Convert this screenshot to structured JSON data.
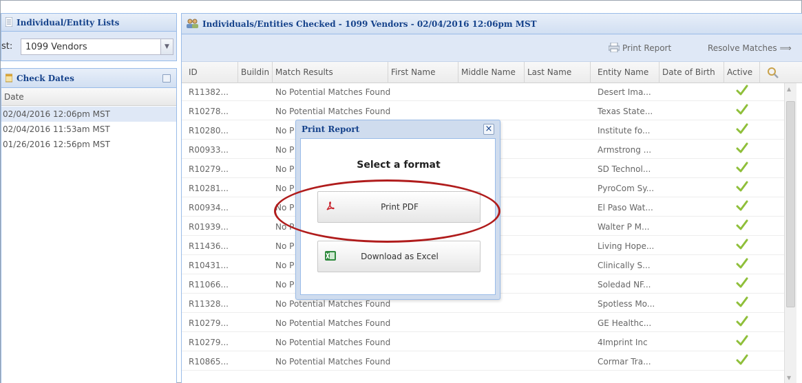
{
  "left_panel": {
    "lists_header": "Individual/Entity Lists",
    "list_label": "st:",
    "list_value": "1099 Vendors",
    "dates_header": "Check Dates",
    "dates_column": "Date",
    "dates": [
      "02/04/2016 12:06pm MST",
      "02/04/2016 11:53am MST",
      "01/26/2016 12:56pm MST"
    ]
  },
  "main_panel": {
    "title": "Individuals/Entities Checked - 1099 Vendors - 02/04/2016 12:06pm MST",
    "toolbar": {
      "print_report": "Print Report",
      "resolve_matches": "Resolve Matches ⟹"
    },
    "columns": [
      "ID",
      "Buildin",
      "Match Results",
      "First Name",
      "Middle Name",
      "Last Name",
      "Entity Name",
      "Date of Birth",
      "Active"
    ],
    "rows": [
      {
        "id": "R11382...",
        "match": "No Potential Matches Found",
        "entity": "Desert Ima..."
      },
      {
        "id": "R10278...",
        "match": "No Potential Matches Found",
        "entity": "Texas State..."
      },
      {
        "id": "R10280...",
        "match": "No P",
        "entity": "Institute fo..."
      },
      {
        "id": "R00933...",
        "match": "No P",
        "entity": "Armstrong ..."
      },
      {
        "id": "R10279...",
        "match": "No P",
        "entity": "SD Technol..."
      },
      {
        "id": "R10281...",
        "match": "No P",
        "entity": "PyroCom Sy..."
      },
      {
        "id": "R00934...",
        "match": "No P",
        "entity": "El Paso Wat..."
      },
      {
        "id": "R01939...",
        "match": "No P",
        "entity": "Walter P M..."
      },
      {
        "id": "R11436...",
        "match": "No P",
        "entity": "Living Hope..."
      },
      {
        "id": "R10431...",
        "match": "No P",
        "entity": "Clinically S..."
      },
      {
        "id": "R11066...",
        "match": "No P",
        "entity": "Soledad NF..."
      },
      {
        "id": "R11328...",
        "match": "No Potential Matches Found",
        "entity": "Spotless Mo..."
      },
      {
        "id": "R10279...",
        "match": "No Potential Matches Found",
        "entity": "GE Healthc..."
      },
      {
        "id": "R10279...",
        "match": "No Potential Matches Found",
        "entity": "4Imprint Inc"
      },
      {
        "id": "R10865...",
        "match": "No Potential Matches Found",
        "entity": "Cormar Tra..."
      }
    ]
  },
  "modal": {
    "title": "Print Report",
    "heading": "Select a format",
    "pdf_label": "Print PDF",
    "excel_label": "Download as Excel"
  },
  "colors": {
    "header_text": "#15428b",
    "panel_bg": "#dfe8f6",
    "border": "#99bbe8",
    "highlight": "#b01c1c",
    "check": "#8fbf3a"
  }
}
